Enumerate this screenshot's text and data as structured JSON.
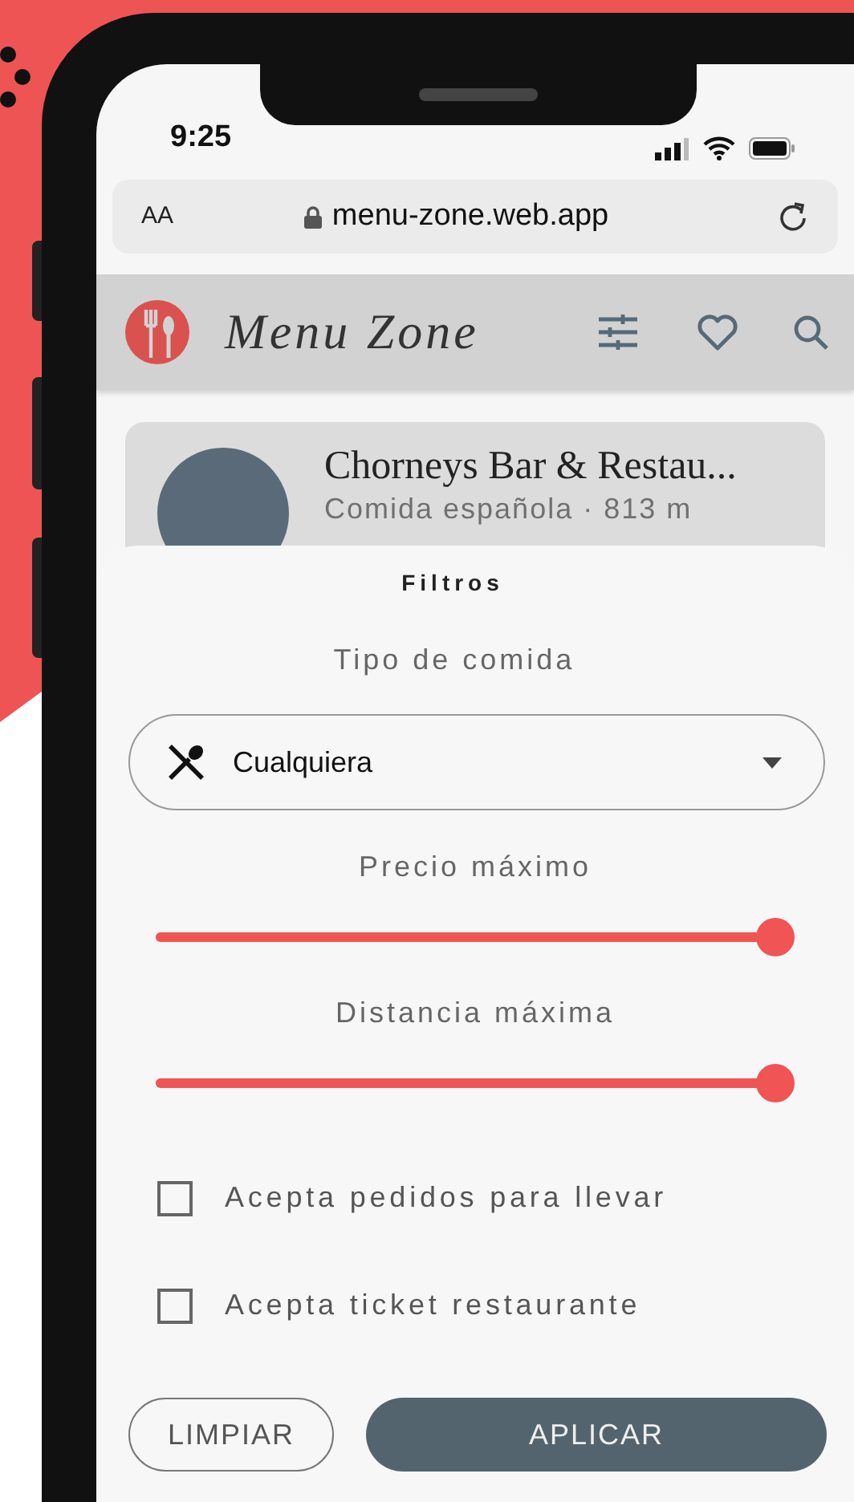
{
  "status_bar": {
    "time": "9:25"
  },
  "browser": {
    "text_size_button": "AA",
    "url": "menu-zone.web.app"
  },
  "app_bar": {
    "title": "Menu Zone"
  },
  "restaurant_card": {
    "name": "Chorneys Bar & Restau...",
    "subtitle": "Comida española · 813 m"
  },
  "filters": {
    "title": "Filtros",
    "food_type": {
      "label": "Tipo de comida",
      "value": "Cualquiera"
    },
    "sliders": [
      {
        "label": "Precio máximo",
        "level": 1
      },
      {
        "label": "Distancia máxima",
        "level": 1
      }
    ],
    "checkboxes": [
      {
        "label": "Acepta pedidos para llevar",
        "checked": false
      },
      {
        "label": "Acepta ticket restaurante",
        "checked": false
      }
    ],
    "buttons": [
      {
        "label": "LIMPIAR",
        "kind": "outline"
      },
      {
        "label": "APLICAR",
        "kind": "filled"
      }
    ]
  }
}
